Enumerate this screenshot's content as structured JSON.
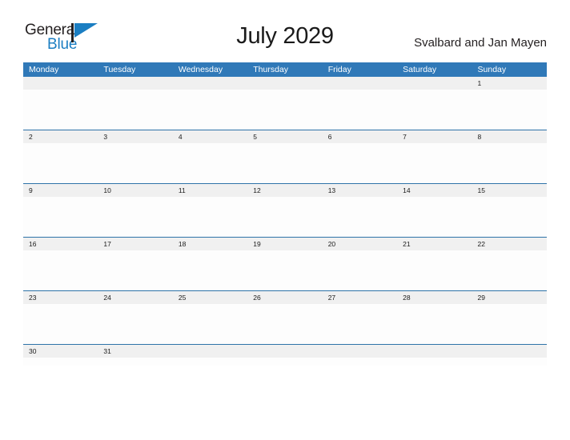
{
  "brand": {
    "name_top": "General",
    "name_bottom": "Blue",
    "flag_icon": "flag-icon",
    "color_blue": "#1b7ec2",
    "color_dark": "#231f20"
  },
  "header": {
    "title": "July 2029",
    "region": "Svalbard and Jan Mayen"
  },
  "calendar": {
    "accent_header_color": "#3079b8",
    "rule_color": "#2e73a8",
    "date_band_color": "#f0f0f0",
    "day_names": [
      "Monday",
      "Tuesday",
      "Wednesday",
      "Thursday",
      "Friday",
      "Saturday",
      "Sunday"
    ],
    "weeks": [
      [
        "",
        "",
        "",
        "",
        "",
        "",
        "1"
      ],
      [
        "2",
        "3",
        "4",
        "5",
        "6",
        "7",
        "8"
      ],
      [
        "9",
        "10",
        "11",
        "12",
        "13",
        "14",
        "15"
      ],
      [
        "16",
        "17",
        "18",
        "19",
        "20",
        "21",
        "22"
      ],
      [
        "23",
        "24",
        "25",
        "26",
        "27",
        "28",
        "29"
      ],
      [
        "30",
        "31",
        "",
        "",
        "",
        "",
        ""
      ]
    ]
  }
}
